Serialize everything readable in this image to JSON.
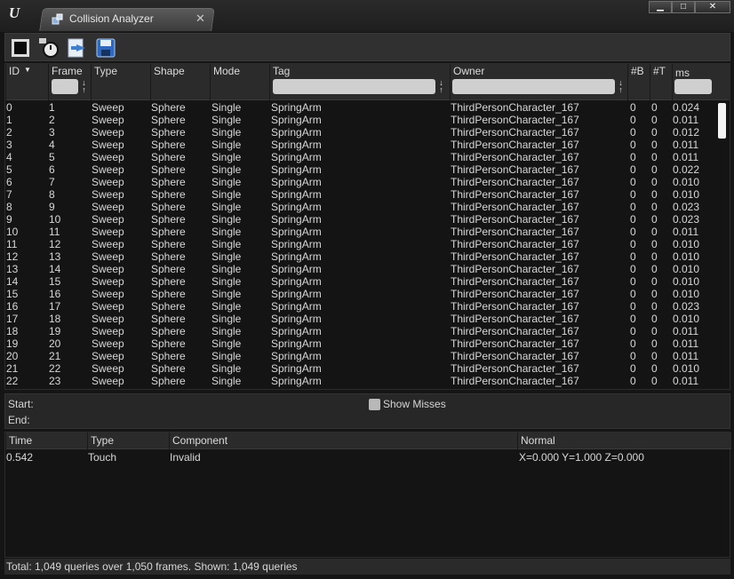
{
  "window": {
    "tab_title": "Collision Analyzer",
    "tab_close": "✕",
    "minimize": "▁",
    "maximize": "□",
    "close": "✕"
  },
  "toolbar": {
    "tools": [
      "record-stop-icon",
      "timer-icon",
      "load-file-icon",
      "save-icon"
    ]
  },
  "grid": {
    "columns": [
      {
        "key": "id",
        "label": "ID",
        "sorted": "descending"
      },
      {
        "key": "frame",
        "label": "Frame"
      },
      {
        "key": "type",
        "label": "Type"
      },
      {
        "key": "shape",
        "label": "Shape"
      },
      {
        "key": "mode",
        "label": "Mode"
      },
      {
        "key": "tag",
        "label": "Tag"
      },
      {
        "key": "owner",
        "label": "Owner"
      },
      {
        "key": "blocking",
        "label": "#B"
      },
      {
        "key": "touching",
        "label": "#T"
      },
      {
        "key": "ms",
        "label": "ms"
      }
    ],
    "rows": [
      [
        "0",
        "1",
        "Sweep",
        "Sphere",
        "Single",
        "SpringArm",
        "ThirdPersonCharacter_167",
        "0",
        "0",
        "0.024"
      ],
      [
        "1",
        "2",
        "Sweep",
        "Sphere",
        "Single",
        "SpringArm",
        "ThirdPersonCharacter_167",
        "0",
        "0",
        "0.011"
      ],
      [
        "2",
        "3",
        "Sweep",
        "Sphere",
        "Single",
        "SpringArm",
        "ThirdPersonCharacter_167",
        "0",
        "0",
        "0.012"
      ],
      [
        "3",
        "4",
        "Sweep",
        "Sphere",
        "Single",
        "SpringArm",
        "ThirdPersonCharacter_167",
        "0",
        "0",
        "0.011"
      ],
      [
        "4",
        "5",
        "Sweep",
        "Sphere",
        "Single",
        "SpringArm",
        "ThirdPersonCharacter_167",
        "0",
        "0",
        "0.011"
      ],
      [
        "5",
        "6",
        "Sweep",
        "Sphere",
        "Single",
        "SpringArm",
        "ThirdPersonCharacter_167",
        "0",
        "0",
        "0.022"
      ],
      [
        "6",
        "7",
        "Sweep",
        "Sphere",
        "Single",
        "SpringArm",
        "ThirdPersonCharacter_167",
        "0",
        "0",
        "0.010"
      ],
      [
        "7",
        "8",
        "Sweep",
        "Sphere",
        "Single",
        "SpringArm",
        "ThirdPersonCharacter_167",
        "0",
        "0",
        "0.010"
      ],
      [
        "8",
        "9",
        "Sweep",
        "Sphere",
        "Single",
        "SpringArm",
        "ThirdPersonCharacter_167",
        "0",
        "0",
        "0.023"
      ],
      [
        "9",
        "10",
        "Sweep",
        "Sphere",
        "Single",
        "SpringArm",
        "ThirdPersonCharacter_167",
        "0",
        "0",
        "0.023"
      ],
      [
        "10",
        "11",
        "Sweep",
        "Sphere",
        "Single",
        "SpringArm",
        "ThirdPersonCharacter_167",
        "0",
        "0",
        "0.011"
      ],
      [
        "11",
        "12",
        "Sweep",
        "Sphere",
        "Single",
        "SpringArm",
        "ThirdPersonCharacter_167",
        "0",
        "0",
        "0.010"
      ],
      [
        "12",
        "13",
        "Sweep",
        "Sphere",
        "Single",
        "SpringArm",
        "ThirdPersonCharacter_167",
        "0",
        "0",
        "0.010"
      ],
      [
        "13",
        "14",
        "Sweep",
        "Sphere",
        "Single",
        "SpringArm",
        "ThirdPersonCharacter_167",
        "0",
        "0",
        "0.010"
      ],
      [
        "14",
        "15",
        "Sweep",
        "Sphere",
        "Single",
        "SpringArm",
        "ThirdPersonCharacter_167",
        "0",
        "0",
        "0.010"
      ],
      [
        "15",
        "16",
        "Sweep",
        "Sphere",
        "Single",
        "SpringArm",
        "ThirdPersonCharacter_167",
        "0",
        "0",
        "0.010"
      ],
      [
        "16",
        "17",
        "Sweep",
        "Sphere",
        "Single",
        "SpringArm",
        "ThirdPersonCharacter_167",
        "0",
        "0",
        "0.023"
      ],
      [
        "17",
        "18",
        "Sweep",
        "Sphere",
        "Single",
        "SpringArm",
        "ThirdPersonCharacter_167",
        "0",
        "0",
        "0.010"
      ],
      [
        "18",
        "19",
        "Sweep",
        "Sphere",
        "Single",
        "SpringArm",
        "ThirdPersonCharacter_167",
        "0",
        "0",
        "0.011"
      ],
      [
        "19",
        "20",
        "Sweep",
        "Sphere",
        "Single",
        "SpringArm",
        "ThirdPersonCharacter_167",
        "0",
        "0",
        "0.011"
      ],
      [
        "20",
        "21",
        "Sweep",
        "Sphere",
        "Single",
        "SpringArm",
        "ThirdPersonCharacter_167",
        "0",
        "0",
        "0.011"
      ],
      [
        "21",
        "22",
        "Sweep",
        "Sphere",
        "Single",
        "SpringArm",
        "ThirdPersonCharacter_167",
        "0",
        "0",
        "0.010"
      ],
      [
        "22",
        "23",
        "Sweep",
        "Sphere",
        "Single",
        "SpringArm",
        "ThirdPersonCharacter_167",
        "0",
        "0",
        "0.011"
      ]
    ]
  },
  "range": {
    "start_label": "Start:",
    "end_label": "End:",
    "show_misses_label": "Show Misses"
  },
  "hits": {
    "columns": [
      "Time",
      "Type",
      "Component",
      "Normal"
    ],
    "rows": [
      [
        "0.542",
        "Touch",
        "Invalid",
        "X=0.000 Y=1.000 Z=0.000"
      ]
    ]
  },
  "status": "Total: 1,049 queries over 1,050 frames. Shown: 1,049 queries"
}
